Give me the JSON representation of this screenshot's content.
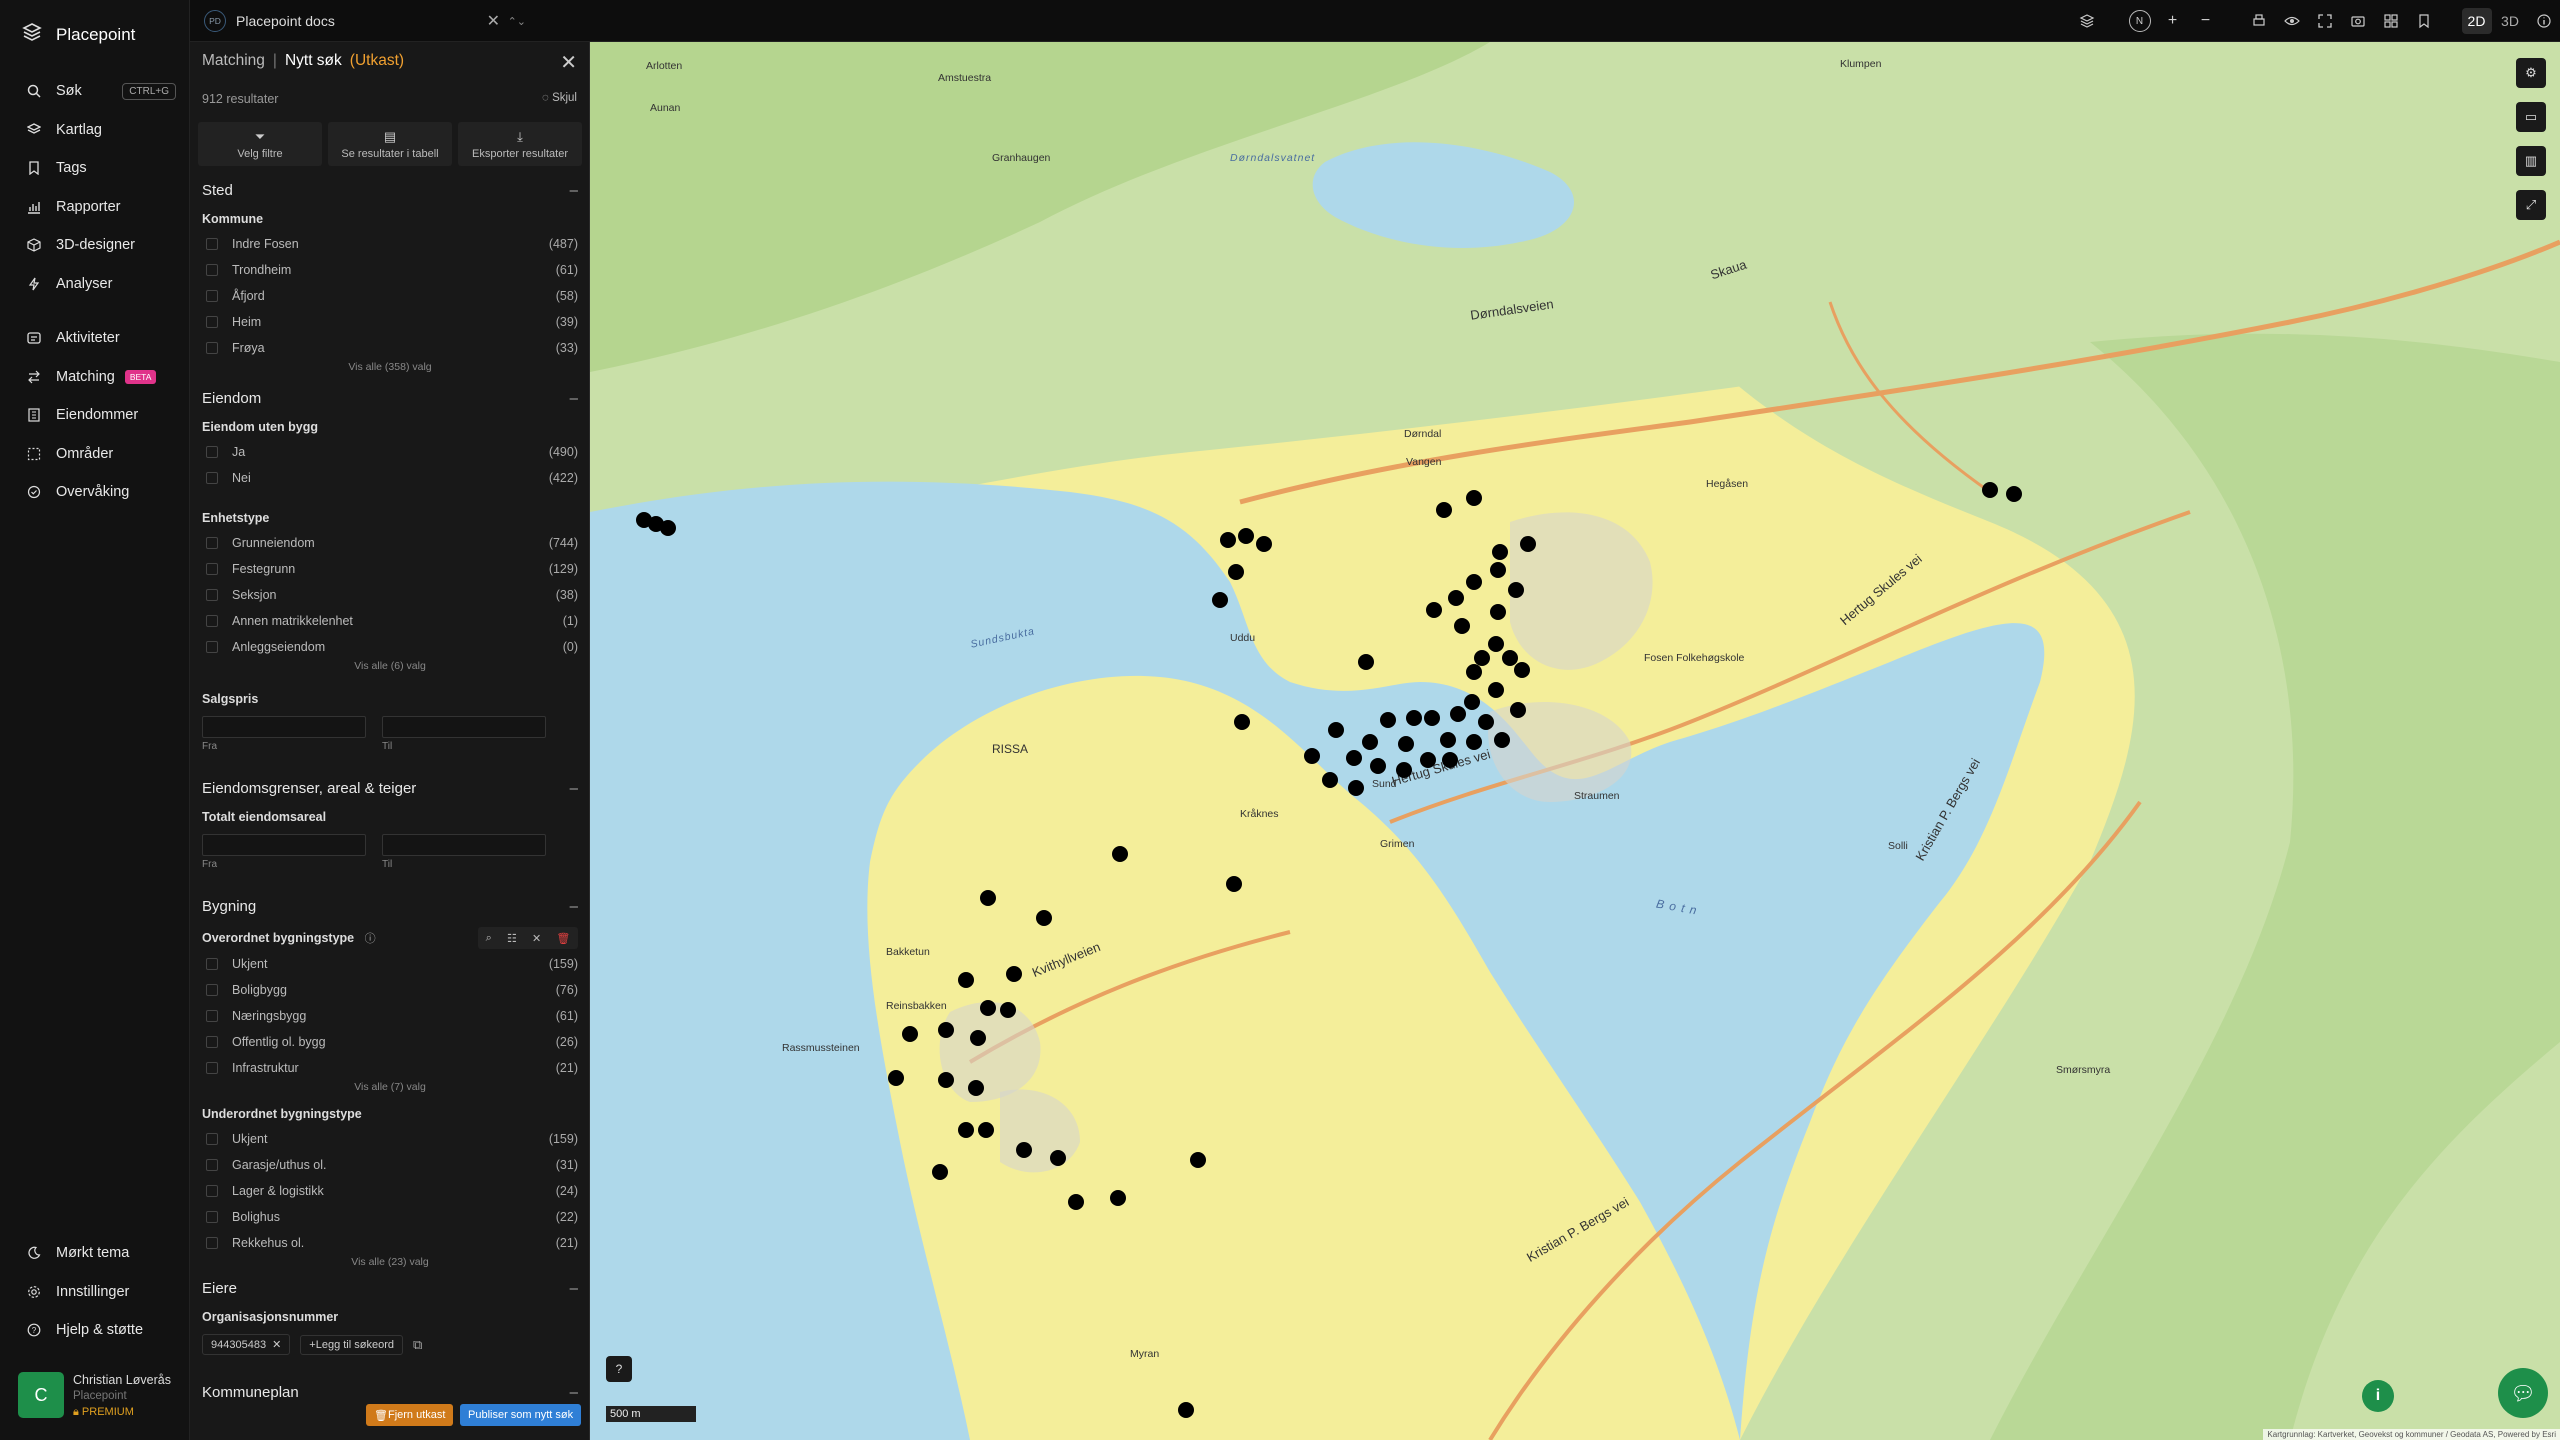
{
  "app": {
    "name": "Placepoint"
  },
  "nav": {
    "items": [
      {
        "label": "Søk",
        "icon": "search-icon",
        "shortcut": "CTRL+G"
      },
      {
        "label": "Kartlag",
        "icon": "layers-icon"
      },
      {
        "label": "Tags",
        "icon": "bookmark-icon"
      },
      {
        "label": "Rapporter",
        "icon": "chart-icon"
      },
      {
        "label": "3D-designer",
        "icon": "cube-icon"
      },
      {
        "label": "Analyser",
        "icon": "bolt-icon"
      }
    ],
    "items2": [
      {
        "label": "Aktiviteter",
        "icon": "activity-icon"
      },
      {
        "label": "Matching",
        "icon": "matching-icon",
        "badge": "BETA"
      },
      {
        "label": "Eiendommer",
        "icon": "building-icon"
      },
      {
        "label": "Områder",
        "icon": "area-icon"
      },
      {
        "label": "Overvåking",
        "icon": "monitor-icon"
      }
    ],
    "bottom": [
      {
        "label": "Mørkt tema",
        "icon": "moon-icon"
      },
      {
        "label": "Innstillinger",
        "icon": "gear-icon"
      },
      {
        "label": "Hjelp & støtte",
        "icon": "help-icon"
      }
    ]
  },
  "user": {
    "initial": "C",
    "name": "Christian Løverås",
    "org": "Placepoint",
    "plan": "PREMIUM"
  },
  "topbar": {
    "doc_badge": "PD",
    "doc_title": "Placepoint docs",
    "mode_2d": "2D",
    "mode_3d": "3D",
    "compass": "N"
  },
  "panel": {
    "crumb": "Matching",
    "title": "Nytt søk",
    "draft": "(Utkast)",
    "count": "912 resultater",
    "hide": "Skjul",
    "actions": [
      "Velg filtre",
      "Se resultater i tabell",
      "Eksporter resultater"
    ],
    "sted": {
      "title": "Sted",
      "sub": "Kommune",
      "options": [
        {
          "label": "Indre Fosen",
          "count": "(487)"
        },
        {
          "label": "Trondheim",
          "count": "(61)"
        },
        {
          "label": "Åfjord",
          "count": "(58)"
        },
        {
          "label": "Heim",
          "count": "(39)"
        },
        {
          "label": "Frøya",
          "count": "(33)"
        }
      ],
      "more": "Vis alle (358) valg"
    },
    "eiendom": {
      "title": "Eiendom",
      "sub1": "Eiendom uten bygg",
      "opt1": [
        {
          "label": "Ja",
          "count": "(490)"
        },
        {
          "label": "Nei",
          "count": "(422)"
        }
      ],
      "sub2": "Enhetstype",
      "opt2": [
        {
          "label": "Grunneiendom",
          "count": "(744)"
        },
        {
          "label": "Festegrunn",
          "count": "(129)"
        },
        {
          "label": "Seksjon",
          "count": "(38)"
        },
        {
          "label": "Annen matrikkelenhet",
          "count": "(1)"
        },
        {
          "label": "Anleggseiendom",
          "count": "(0)"
        }
      ],
      "more": "Vis alle (6) valg",
      "sub3": "Salgspris",
      "from": "Fra",
      "to": "Til"
    },
    "grenser": {
      "title": "Eiendomsgrenser, areal & teiger",
      "sub": "Totalt eiendomsareal",
      "from": "Fra",
      "to": "Til"
    },
    "bygning": {
      "title": "Bygning",
      "sub1": "Overordnet bygningstype",
      "opt1": [
        {
          "label": "Ukjent",
          "count": "(159)"
        },
        {
          "label": "Boligbygg",
          "count": "(76)"
        },
        {
          "label": "Næringsbygg",
          "count": "(61)"
        },
        {
          "label": "Offentlig ol. bygg",
          "count": "(26)"
        },
        {
          "label": "Infrastruktur",
          "count": "(21)"
        }
      ],
      "more1": "Vis alle (7) valg",
      "sub2": "Underordnet bygningstype",
      "opt2": [
        {
          "label": "Ukjent",
          "count": "(159)"
        },
        {
          "label": "Garasje/uthus ol.",
          "count": "(31)"
        },
        {
          "label": "Lager & logistikk",
          "count": "(24)"
        },
        {
          "label": "Bolighus",
          "count": "(22)"
        },
        {
          "label": "Rekkehus ol.",
          "count": "(21)"
        }
      ],
      "more2": "Vis alle (23) valg"
    },
    "eiere": {
      "title": "Eiere",
      "sub": "Organisasjonsnummer",
      "chip": "944305483",
      "add": "Legg til søkeord"
    },
    "kommuneplan": {
      "title": "Kommuneplan"
    },
    "btn_remove": "Fjern utkast",
    "btn_publish": "Publiser som nytt søk"
  },
  "map": {
    "scale": "500 m",
    "attribution": "Kartgrunnlag: Kartverket, Geovekst og kommuner / Geodata AS, Powered by Esri",
    "labels": {
      "aunan": "Aunan",
      "arlotten": "Arlotten",
      "amstuestra": "Amstuestra",
      "klumpen": "Klumpen",
      "granhaugen": "Granhaugen",
      "dorndalsvatnet": "Dørndalsvatnet",
      "skaua": "Skaua",
      "dorndalsveien": "Dørndalsveien",
      "dorndal": "Dørndal",
      "vangen": "Vangen",
      "hegasen": "Hegåsen",
      "rissa": "RISSA",
      "sundsbukta": "Sundsbukta",
      "hertug": "Hertug Skules vei",
      "botn": "B o t n",
      "kvithyllveien": "Kvithyllveien",
      "straumen": "Straumen",
      "kristian": "Kristian P. Bergs vei",
      "reinsbakken": "Reinsbakken",
      "rassmussteinen": "Rassmussteinen",
      "fosen": "Fosen Folkehøgskole",
      "sund": "Sund",
      "uddu": "Uddu",
      "grimen": "Grimen",
      "myran": "Myran",
      "bakketun": "Bakketun",
      "kraknes": "Kråknes",
      "solli": "Solli",
      "smorsmyra": "Smørsmyra"
    }
  }
}
